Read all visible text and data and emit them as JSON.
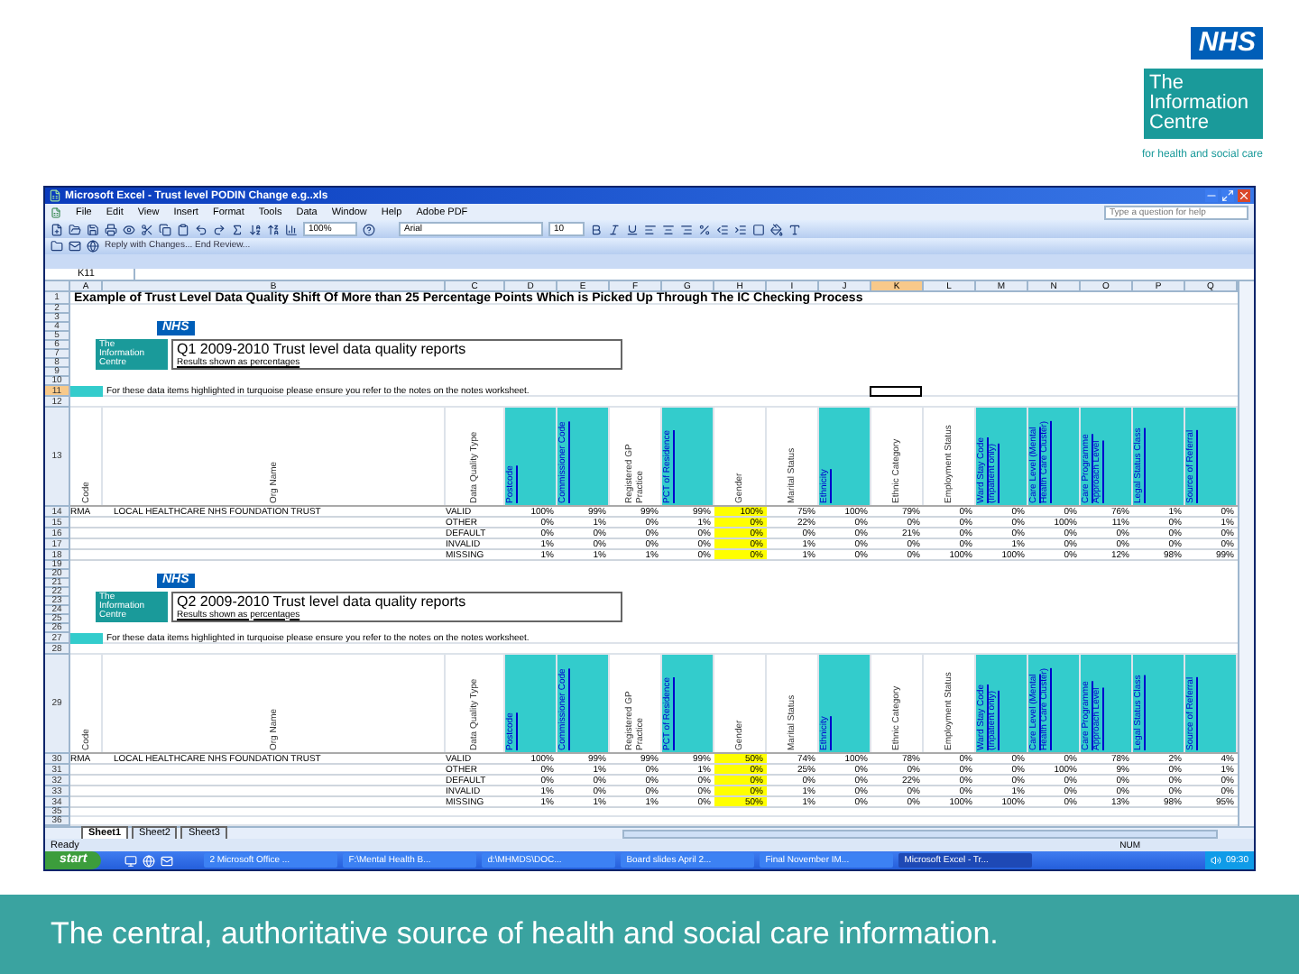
{
  "slide": {
    "logo": {
      "nhs": "NHS",
      "name_lines": [
        "The",
        "Information",
        "Centre"
      ],
      "tagline": "for health and social care"
    },
    "caption": "The central, authoritative source of health and social care information."
  },
  "window": {
    "title": "Microsoft Excel - Trust level PODIN Change e.g..xls",
    "menu": [
      "File",
      "Edit",
      "View",
      "Insert",
      "Format",
      "Tools",
      "Data",
      "Window",
      "Help",
      "Adobe PDF"
    ],
    "help_placeholder": "Type a question for help",
    "zoom": "100%",
    "font": "Arial",
    "font_size": "10",
    "review_toolbar": "Reply with Changes...  End Review...",
    "name_box": "K11"
  },
  "columns": [
    {
      "label": "A",
      "selected": false
    },
    {
      "label": "B",
      "selected": false
    },
    {
      "label": "C",
      "selected": false
    },
    {
      "label": "D",
      "selected": false
    },
    {
      "label": "E",
      "selected": false
    },
    {
      "label": "F",
      "selected": false
    },
    {
      "label": "G",
      "selected": false
    },
    {
      "label": "H",
      "selected": false
    },
    {
      "label": "I",
      "selected": false
    },
    {
      "label": "J",
      "selected": false
    },
    {
      "label": "K",
      "selected": true
    },
    {
      "label": "L",
      "selected": false
    },
    {
      "label": "M",
      "selected": false
    },
    {
      "label": "N",
      "selected": false
    },
    {
      "label": "O",
      "selected": false
    },
    {
      "label": "P",
      "selected": false
    },
    {
      "label": "Q",
      "selected": false
    }
  ],
  "sheet": {
    "title_row": {
      "label": "1",
      "text": "Example of Trust Level Data Quality Shift Of More than 25 Percentage Points Which is Picked Up Through The IC Checking Process"
    },
    "reports": [
      {
        "logo_rows": [
          "2",
          "3",
          "4",
          "5",
          "6",
          "7",
          "8",
          "9",
          "10"
        ],
        "nhs": "NHS",
        "ic_lines": [
          "The",
          "Information",
          "Centre"
        ],
        "title": "Q1 2009-2010  Trust level data quality reports",
        "subtitle": "Results shown as percentages",
        "note_rows": [
          {
            "label": "11",
            "selected": true
          },
          {
            "label": "12",
            "selected": false
          }
        ],
        "note": "For these data items highlighted in turquoise please ensure you refer to the notes on the notes worksheet.",
        "header_row": "13",
        "label_headers": [
          "Code",
          "Org Name",
          "Data Quality Type"
        ],
        "headers": [
          {
            "text": "Postcode",
            "linked": true,
            "flagged": false
          },
          {
            "text": "Commissioner Code",
            "linked": true,
            "flagged": false
          },
          {
            "text": "Registered GP Practice",
            "linked": false,
            "flagged": false
          },
          {
            "text": "PCT of Residence",
            "linked": true,
            "flagged": false
          },
          {
            "text": "Gender",
            "linked": false,
            "flagged": true
          },
          {
            "text": "Marital Status",
            "linked": false,
            "flagged": false
          },
          {
            "text": "Ethnicity",
            "linked": true,
            "flagged": false
          },
          {
            "text": "Ethnic Category",
            "linked": false,
            "flagged": false
          },
          {
            "text": "Employment Status",
            "linked": false,
            "flagged": false
          },
          {
            "text": "Ward Stay Code (Inpatient only)",
            "linked": true,
            "flagged": false
          },
          {
            "text": "Care Level (Mental Health Care Cluster)",
            "linked": true,
            "flagged": false
          },
          {
            "text": "Care Programme Approach Level",
            "linked": true,
            "flagged": false
          },
          {
            "text": "Legal Status Class",
            "linked": true,
            "flagged": false
          },
          {
            "text": "Source of Referral",
            "linked": true,
            "flagged": false
          }
        ],
        "code": "RMA",
        "org": "LOCAL HEALTHCARE NHS FOUNDATION TRUST",
        "rows": [
          {
            "label": "14",
            "measure": "VALID",
            "values": [
              "100%",
              "99%",
              "99%",
              "99%",
              "100%",
              "75%",
              "100%",
              "79%",
              "0%",
              "0%",
              "0%",
              "76%",
              "1%",
              "0%"
            ]
          },
          {
            "label": "15",
            "measure": "OTHER",
            "values": [
              "0%",
              "1%",
              "0%",
              "1%",
              "0%",
              "22%",
              "0%",
              "0%",
              "0%",
              "0%",
              "100%",
              "11%",
              "0%",
              "1%"
            ]
          },
          {
            "label": "16",
            "measure": "DEFAULT",
            "values": [
              "0%",
              "0%",
              "0%",
              "0%",
              "0%",
              "0%",
              "0%",
              "21%",
              "0%",
              "0%",
              "0%",
              "0%",
              "0%",
              "0%"
            ]
          },
          {
            "label": "17",
            "measure": "INVALID",
            "values": [
              "1%",
              "0%",
              "0%",
              "0%",
              "0%",
              "1%",
              "0%",
              "0%",
              "0%",
              "1%",
              "0%",
              "0%",
              "0%",
              "0%"
            ]
          },
          {
            "label": "18",
            "measure": "MISSING",
            "values": [
              "1%",
              "1%",
              "1%",
              "0%",
              "0%",
              "1%",
              "0%",
              "0%",
              "100%",
              "100%",
              "0%",
              "12%",
              "98%",
              "99%"
            ]
          }
        ]
      },
      {
        "logo_rows": [
          "19",
          "20",
          "21",
          "22",
          "23",
          "24",
          "25",
          "26"
        ],
        "nhs": "NHS",
        "ic_lines": [
          "The",
          "Information",
          "Centre"
        ],
        "title": "Q2 2009-2010  Trust level data quality reports",
        "subtitle": "Results shown as percentages",
        "note_rows": [
          {
            "label": "27",
            "selected": false
          },
          {
            "label": "28",
            "selected": false
          }
        ],
        "note": "For these data items highlighted in turquoise please ensure you refer to the notes on the notes worksheet.",
        "header_row": "29",
        "label_headers": [
          "Code",
          "Org Name",
          "Data Quality Type"
        ],
        "headers": [
          {
            "text": "Postcode",
            "linked": true,
            "flagged": false
          },
          {
            "text": "Commissioner Code",
            "linked": true,
            "flagged": false
          },
          {
            "text": "Registered GP Practice",
            "linked": false,
            "flagged": false
          },
          {
            "text": "PCT of Residence",
            "linked": true,
            "flagged": false
          },
          {
            "text": "Gender",
            "linked": false,
            "flagged": true
          },
          {
            "text": "Marital Status",
            "linked": false,
            "flagged": false
          },
          {
            "text": "Ethnicity",
            "linked": true,
            "flagged": false
          },
          {
            "text": "Ethnic Category",
            "linked": false,
            "flagged": false
          },
          {
            "text": "Employment Status",
            "linked": false,
            "flagged": false
          },
          {
            "text": "Ward Stay Code (Inpatient only)",
            "linked": true,
            "flagged": false
          },
          {
            "text": "Care Level (Mental Health Care Cluster)",
            "linked": true,
            "flagged": false
          },
          {
            "text": "Care Programme Approach Level",
            "linked": true,
            "flagged": false
          },
          {
            "text": "Legal Status Class",
            "linked": true,
            "flagged": false
          },
          {
            "text": "Source of Referral",
            "linked": true,
            "flagged": false
          }
        ],
        "code": "RMA",
        "org": "LOCAL HEALTHCARE NHS FOUNDATION TRUST",
        "rows": [
          {
            "label": "30",
            "measure": "VALID",
            "values": [
              "100%",
              "99%",
              "99%",
              "99%",
              "50%",
              "74%",
              "100%",
              "78%",
              "0%",
              "0%",
              "0%",
              "78%",
              "2%",
              "4%"
            ]
          },
          {
            "label": "31",
            "measure": "OTHER",
            "values": [
              "0%",
              "1%",
              "0%",
              "1%",
              "0%",
              "25%",
              "0%",
              "0%",
              "0%",
              "0%",
              "100%",
              "9%",
              "0%",
              "1%"
            ]
          },
          {
            "label": "32",
            "measure": "DEFAULT",
            "values": [
              "0%",
              "0%",
              "0%",
              "0%",
              "0%",
              "0%",
              "0%",
              "22%",
              "0%",
              "0%",
              "0%",
              "0%",
              "0%",
              "0%"
            ]
          },
          {
            "label": "33",
            "measure": "INVALID",
            "values": [
              "1%",
              "0%",
              "0%",
              "0%",
              "0%",
              "1%",
              "0%",
              "0%",
              "0%",
              "1%",
              "0%",
              "0%",
              "0%",
              "0%"
            ]
          },
          {
            "label": "34",
            "measure": "MISSING",
            "values": [
              "1%",
              "1%",
              "1%",
              "0%",
              "50%",
              "1%",
              "0%",
              "0%",
              "100%",
              "100%",
              "0%",
              "13%",
              "98%",
              "95%"
            ]
          }
        ]
      }
    ],
    "trailing_rows": [
      "35",
      "36"
    ]
  },
  "sheet_tabs": [
    {
      "label": "Sheet1",
      "selected": true
    },
    {
      "label": "Sheet2",
      "selected": false
    },
    {
      "label": "Sheet3",
      "selected": false
    }
  ],
  "status_bar": {
    "left": "Ready",
    "right": "NUM"
  },
  "taskbar": {
    "start": "start",
    "items": [
      {
        "label": "2 Microsoft Office ...",
        "selected": false
      },
      {
        "label": "F:\\Mental Health B...",
        "selected": false
      },
      {
        "label": "d:\\MHMDS\\DOC...",
        "selected": false
      },
      {
        "label": "Board slides April 2...",
        "selected": false
      },
      {
        "label": "Final November IM...",
        "selected": false
      },
      {
        "label": "Microsoft Excel - Tr...",
        "selected": true
      }
    ],
    "clock": "09:30"
  }
}
